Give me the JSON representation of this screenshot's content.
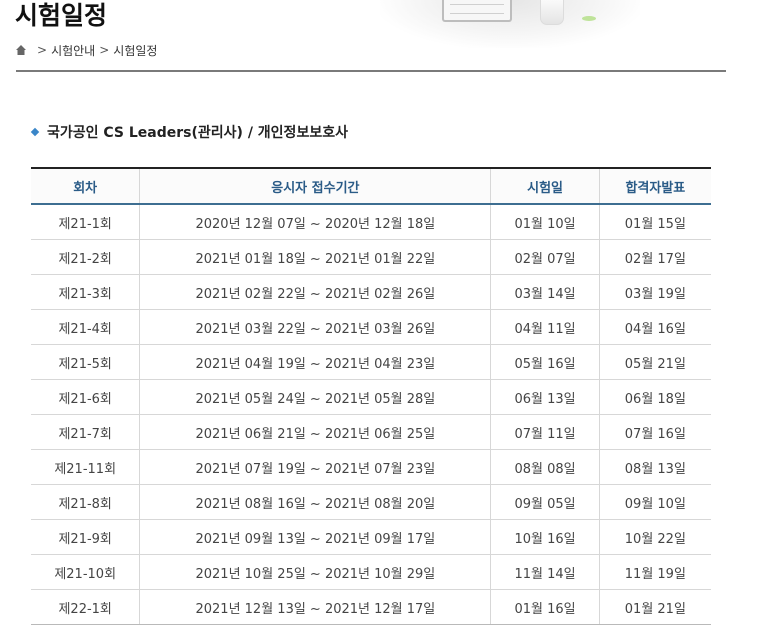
{
  "page": {
    "title": "시험일정"
  },
  "breadcrumb": {
    "home_icon": "home-icon",
    "items": [
      "시험안내",
      "시험일정"
    ],
    "separator": ">"
  },
  "section": {
    "title": "국가공인 CS Leaders(관리사) / 개인정보보호사",
    "bullet_color": "#3a86c8"
  },
  "table": {
    "headers": [
      "회차",
      "응시자 접수기간",
      "시험일",
      "합격자발표"
    ],
    "rows": [
      [
        "제21-1회",
        "2020년 12월 07일 ~ 2020년 12월 18일",
        "01월 10일",
        "01월 15일"
      ],
      [
        "제21-2회",
        "2021년 01월 18일 ~ 2021년 01월 22일",
        "02월 07일",
        "02월 17일"
      ],
      [
        "제21-3회",
        "2021년 02월 22일 ~ 2021년 02월 26일",
        "03월 14일",
        "03월 19일"
      ],
      [
        "제21-4회",
        "2021년 03월 22일 ~ 2021년 03월 26일",
        "04월 11일",
        "04월 16일"
      ],
      [
        "제21-5회",
        "2021년 04월 19일 ~ 2021년 04월 23일",
        "05월 16일",
        "05월 21일"
      ],
      [
        "제21-6회",
        "2021년 05월 24일 ~ 2021년 05월 28일",
        "06월 13일",
        "06월 18일"
      ],
      [
        "제21-7회",
        "2021년 06월 21일 ~ 2021년 06월 25일",
        "07월 11일",
        "07월 16일"
      ],
      [
        "제21-11회",
        "2021년 07월 19일 ~ 2021년 07월 23일",
        "08월 08일",
        "08월 13일"
      ],
      [
        "제21-8회",
        "2021년 08월 16일 ~ 2021년 08월 20일",
        "09월 05일",
        "09월 10일"
      ],
      [
        "제21-9회",
        "2021년 09월 13일 ~ 2021년 09월 17일",
        "10월 16일",
        "10월 22일"
      ],
      [
        "제21-10회",
        "2021년 10월 25일 ~ 2021년 10월 29일",
        "11월 14일",
        "11월 19일"
      ],
      [
        "제22-1회",
        "2021년 12월 13일 ~ 2021년 12월 17일",
        "01월 16일",
        "01월 21일"
      ]
    ]
  },
  "colors": {
    "header_text": "#2a5b87",
    "title_rule": "#7a7a7a"
  }
}
